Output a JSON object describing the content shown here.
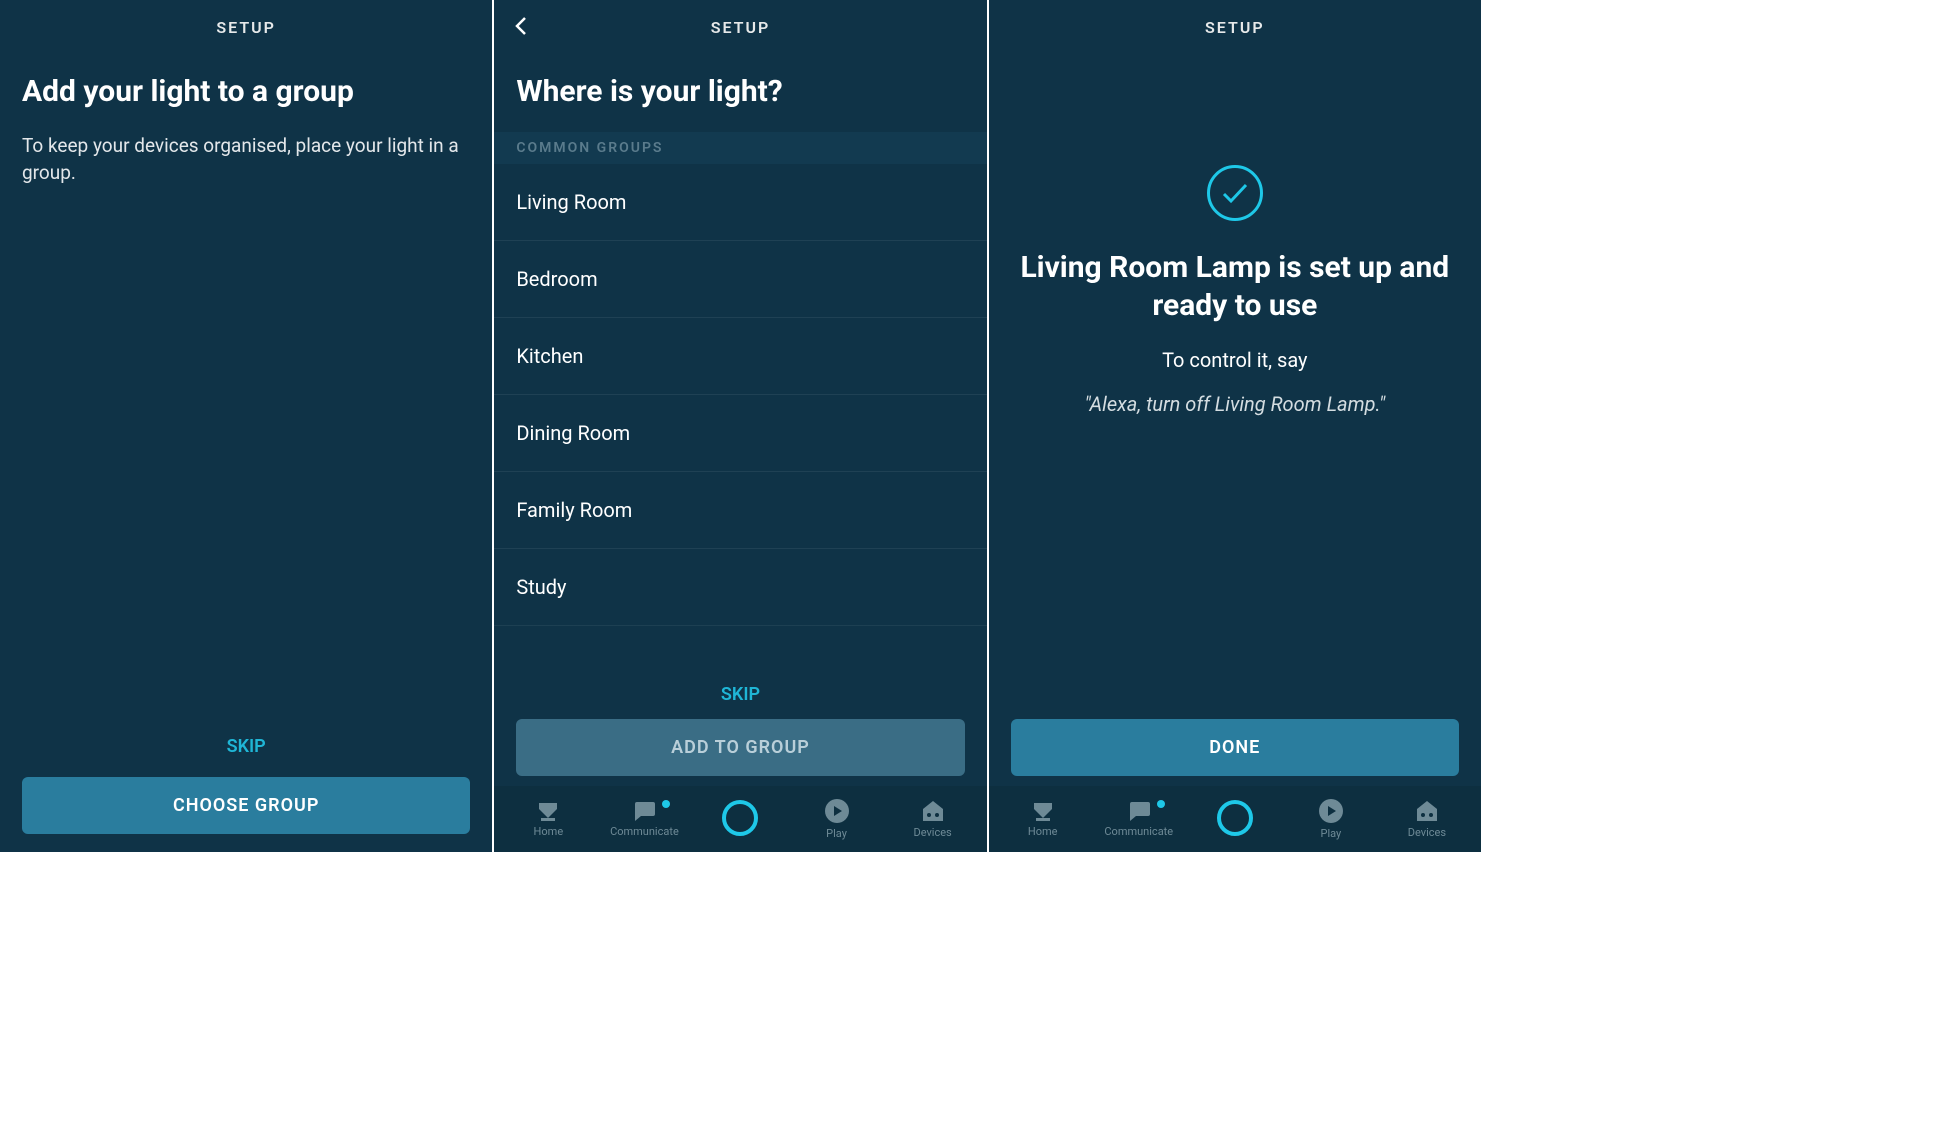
{
  "colors": {
    "bg": "#0f3347",
    "accent": "#1ec8e8",
    "button": "#2a7d9e"
  },
  "screens": [
    {
      "header": "SETUP",
      "title": "Add your light to a group",
      "description": "To keep your devices organised, place your light in a group.",
      "skip_label": "SKIP",
      "primary_label": "CHOOSE GROUP"
    },
    {
      "header": "SETUP",
      "title": "Where is your light?",
      "section_label": "COMMON GROUPS",
      "groups": [
        "Living Room",
        "Bedroom",
        "Kitchen",
        "Dining Room",
        "Family Room",
        "Study"
      ],
      "skip_label": "SKIP",
      "primary_label": "ADD TO GROUP"
    },
    {
      "header": "SETUP",
      "success_title": "Living Room Lamp is set up and ready to use",
      "success_sub": "To control it, say",
      "success_quote": "\"Alexa, turn off Living Room Lamp.\"",
      "primary_label": "DONE"
    }
  ],
  "tabbar": [
    {
      "label": "Home"
    },
    {
      "label": "Communicate"
    },
    {
      "label": ""
    },
    {
      "label": "Play"
    },
    {
      "label": "Devices"
    }
  ]
}
